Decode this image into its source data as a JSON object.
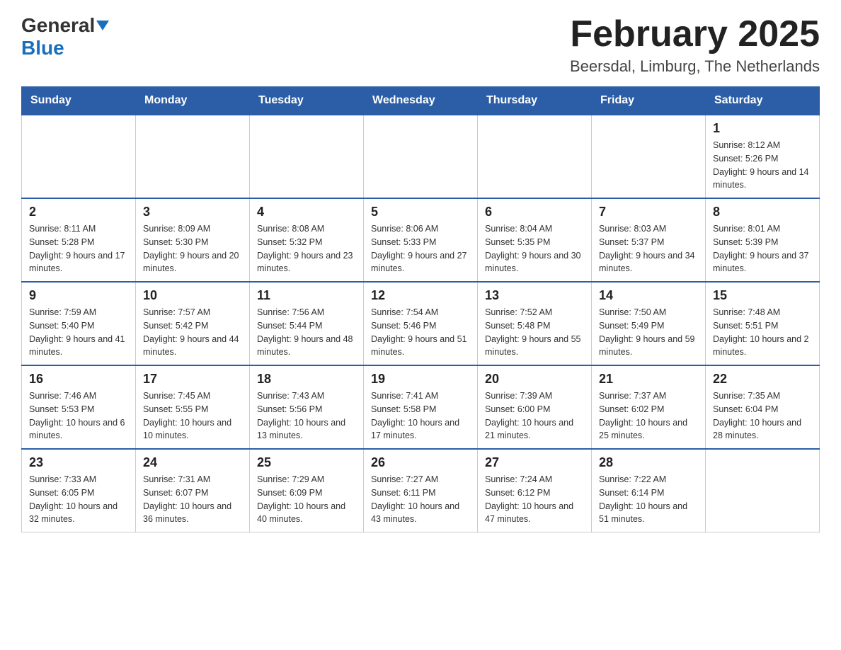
{
  "header": {
    "logo_general": "General",
    "logo_blue": "Blue",
    "main_title": "February 2025",
    "subtitle": "Beersdal, Limburg, The Netherlands"
  },
  "days_of_week": [
    "Sunday",
    "Monday",
    "Tuesday",
    "Wednesday",
    "Thursday",
    "Friday",
    "Saturday"
  ],
  "weeks": [
    [
      {
        "day": "",
        "info": ""
      },
      {
        "day": "",
        "info": ""
      },
      {
        "day": "",
        "info": ""
      },
      {
        "day": "",
        "info": ""
      },
      {
        "day": "",
        "info": ""
      },
      {
        "day": "",
        "info": ""
      },
      {
        "day": "1",
        "info": "Sunrise: 8:12 AM\nSunset: 5:26 PM\nDaylight: 9 hours and 14 minutes."
      }
    ],
    [
      {
        "day": "2",
        "info": "Sunrise: 8:11 AM\nSunset: 5:28 PM\nDaylight: 9 hours and 17 minutes."
      },
      {
        "day": "3",
        "info": "Sunrise: 8:09 AM\nSunset: 5:30 PM\nDaylight: 9 hours and 20 minutes."
      },
      {
        "day": "4",
        "info": "Sunrise: 8:08 AM\nSunset: 5:32 PM\nDaylight: 9 hours and 23 minutes."
      },
      {
        "day": "5",
        "info": "Sunrise: 8:06 AM\nSunset: 5:33 PM\nDaylight: 9 hours and 27 minutes."
      },
      {
        "day": "6",
        "info": "Sunrise: 8:04 AM\nSunset: 5:35 PM\nDaylight: 9 hours and 30 minutes."
      },
      {
        "day": "7",
        "info": "Sunrise: 8:03 AM\nSunset: 5:37 PM\nDaylight: 9 hours and 34 minutes."
      },
      {
        "day": "8",
        "info": "Sunrise: 8:01 AM\nSunset: 5:39 PM\nDaylight: 9 hours and 37 minutes."
      }
    ],
    [
      {
        "day": "9",
        "info": "Sunrise: 7:59 AM\nSunset: 5:40 PM\nDaylight: 9 hours and 41 minutes."
      },
      {
        "day": "10",
        "info": "Sunrise: 7:57 AM\nSunset: 5:42 PM\nDaylight: 9 hours and 44 minutes."
      },
      {
        "day": "11",
        "info": "Sunrise: 7:56 AM\nSunset: 5:44 PM\nDaylight: 9 hours and 48 minutes."
      },
      {
        "day": "12",
        "info": "Sunrise: 7:54 AM\nSunset: 5:46 PM\nDaylight: 9 hours and 51 minutes."
      },
      {
        "day": "13",
        "info": "Sunrise: 7:52 AM\nSunset: 5:48 PM\nDaylight: 9 hours and 55 minutes."
      },
      {
        "day": "14",
        "info": "Sunrise: 7:50 AM\nSunset: 5:49 PM\nDaylight: 9 hours and 59 minutes."
      },
      {
        "day": "15",
        "info": "Sunrise: 7:48 AM\nSunset: 5:51 PM\nDaylight: 10 hours and 2 minutes."
      }
    ],
    [
      {
        "day": "16",
        "info": "Sunrise: 7:46 AM\nSunset: 5:53 PM\nDaylight: 10 hours and 6 minutes."
      },
      {
        "day": "17",
        "info": "Sunrise: 7:45 AM\nSunset: 5:55 PM\nDaylight: 10 hours and 10 minutes."
      },
      {
        "day": "18",
        "info": "Sunrise: 7:43 AM\nSunset: 5:56 PM\nDaylight: 10 hours and 13 minutes."
      },
      {
        "day": "19",
        "info": "Sunrise: 7:41 AM\nSunset: 5:58 PM\nDaylight: 10 hours and 17 minutes."
      },
      {
        "day": "20",
        "info": "Sunrise: 7:39 AM\nSunset: 6:00 PM\nDaylight: 10 hours and 21 minutes."
      },
      {
        "day": "21",
        "info": "Sunrise: 7:37 AM\nSunset: 6:02 PM\nDaylight: 10 hours and 25 minutes."
      },
      {
        "day": "22",
        "info": "Sunrise: 7:35 AM\nSunset: 6:04 PM\nDaylight: 10 hours and 28 minutes."
      }
    ],
    [
      {
        "day": "23",
        "info": "Sunrise: 7:33 AM\nSunset: 6:05 PM\nDaylight: 10 hours and 32 minutes."
      },
      {
        "day": "24",
        "info": "Sunrise: 7:31 AM\nSunset: 6:07 PM\nDaylight: 10 hours and 36 minutes."
      },
      {
        "day": "25",
        "info": "Sunrise: 7:29 AM\nSunset: 6:09 PM\nDaylight: 10 hours and 40 minutes."
      },
      {
        "day": "26",
        "info": "Sunrise: 7:27 AM\nSunset: 6:11 PM\nDaylight: 10 hours and 43 minutes."
      },
      {
        "day": "27",
        "info": "Sunrise: 7:24 AM\nSunset: 6:12 PM\nDaylight: 10 hours and 47 minutes."
      },
      {
        "day": "28",
        "info": "Sunrise: 7:22 AM\nSunset: 6:14 PM\nDaylight: 10 hours and 51 minutes."
      },
      {
        "day": "",
        "info": ""
      }
    ]
  ]
}
